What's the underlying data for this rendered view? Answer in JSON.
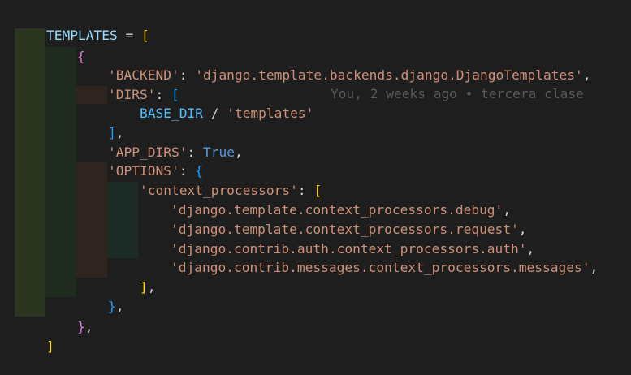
{
  "editor": {
    "colors": {
      "background": "#1e1e1e",
      "indent_level_1": "#2b3520",
      "indent_level_2": "#1f2b1f",
      "indent_level_3": "#2e2521",
      "indent_level_4": "#1d2b27",
      "string": "#ce9178",
      "variable": "#9cdcfe",
      "keyword": "#569cd6",
      "bracket_gold": "#ffd700",
      "bracket_orchid": "#da70d6",
      "bracket_blue": "#179fff"
    },
    "tokens": {
      "templates": "TEMPLATES",
      "eq": " = ",
      "open_list": "[",
      "open_dict": "{",
      "backend_key": "'BACKEND'",
      "colon": ": ",
      "backend_val": "'django.template.backends.django.DjangoTemplates'",
      "comma": ",",
      "dirs_key": "'DIRS'",
      "open_dirs": "[",
      "base_dir": "BASE_DIR",
      "slash": " / ",
      "templates_str": "'templates'",
      "close_dirs": "]",
      "app_dirs_key": "'APP_DIRS'",
      "true_val": "True",
      "options_key": "'OPTIONS'",
      "open_options": "{",
      "cp_key": "'context_processors'",
      "open_cp": "[",
      "cp_debug": "'django.template.context_processors.debug'",
      "cp_request": "'django.template.context_processors.request'",
      "cp_auth": "'django.contrib.auth.context_processors.auth'",
      "cp_messages": "'django.contrib.messages.context_processors.messages'",
      "close_cp": "]",
      "close_options": "}",
      "close_dict": "}",
      "close_list": "]"
    },
    "blame": "You, 2 weeks ago • tercera clase"
  }
}
